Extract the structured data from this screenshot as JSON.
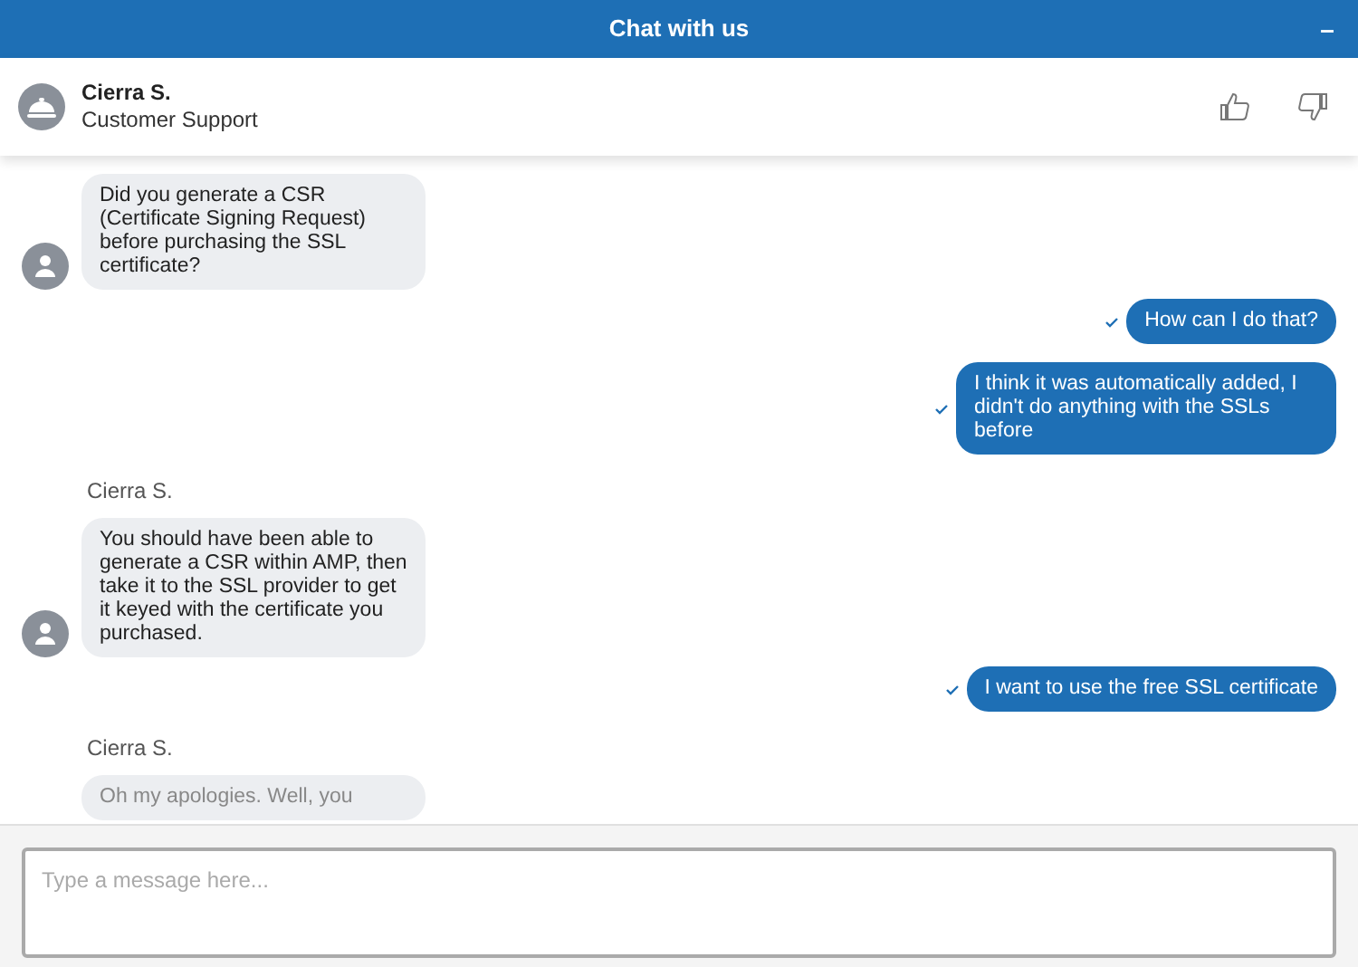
{
  "header": {
    "title": "Chat with us",
    "minimize": "–"
  },
  "agent": {
    "name": "Cierra S.",
    "role": "Customer Support"
  },
  "messages": [
    {
      "kind": "agent",
      "text": "Did you generate a CSR (Certificate Signing Request) before purchasing the SSL certificate?"
    },
    {
      "kind": "user",
      "delivered": true,
      "text": "How can I do that?"
    },
    {
      "kind": "user",
      "delivered": true,
      "text": "I think it was automatically added, I didn't do anything with the SSLs before"
    },
    {
      "kind": "agent",
      "sender": "Cierra S.",
      "text": "You should have been able to generate a CSR within AMP, then take it to the SSL provider to get it keyed with the certificate you purchased."
    },
    {
      "kind": "user",
      "delivered": true,
      "text": "I want to use the free SSL certificate"
    },
    {
      "kind": "agent",
      "sender": "Cierra S.",
      "avatar": false,
      "text": "Oh my apologies. Well, you"
    }
  ],
  "composer": {
    "placeholder": "Type a message here..."
  }
}
